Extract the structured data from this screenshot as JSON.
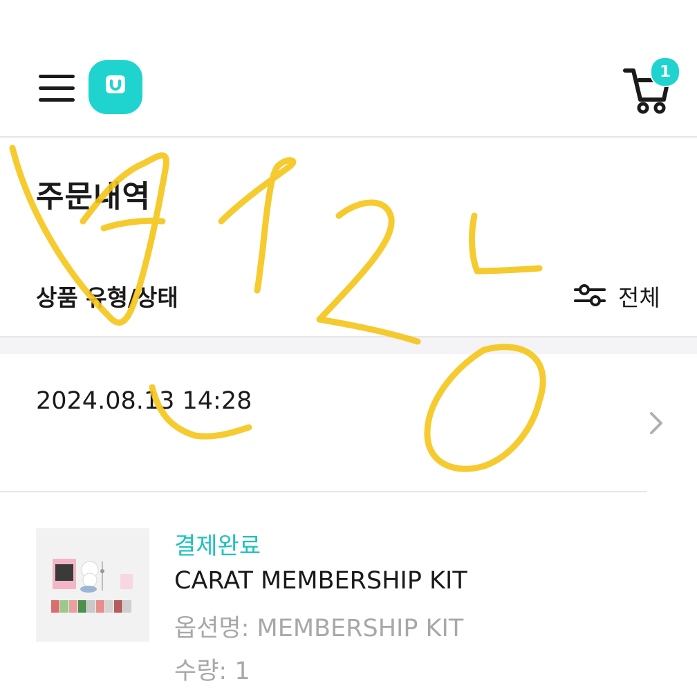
{
  "header": {
    "menu_icon": "hamburger-menu-icon",
    "logo_icon": "shopping-bag-logo-icon",
    "cart_icon": "cart-icon",
    "cart_count": "1",
    "accent_color": "#1fd4cf"
  },
  "page": {
    "title": "주문내역"
  },
  "filter": {
    "label": "상품 유형/상태",
    "icon": "sliders-filter-icon",
    "value": "전체"
  },
  "order": {
    "date": "2024.08.13 14:28",
    "chevron_icon": "chevron-right-icon",
    "item": {
      "status": "결제완료",
      "status_color": "#1fc3bd",
      "name": "CARAT MEMBERSHIP KIT",
      "option": "옵션명: MEMBERSHIP KIT",
      "quantity": "수량: 1"
    }
  }
}
